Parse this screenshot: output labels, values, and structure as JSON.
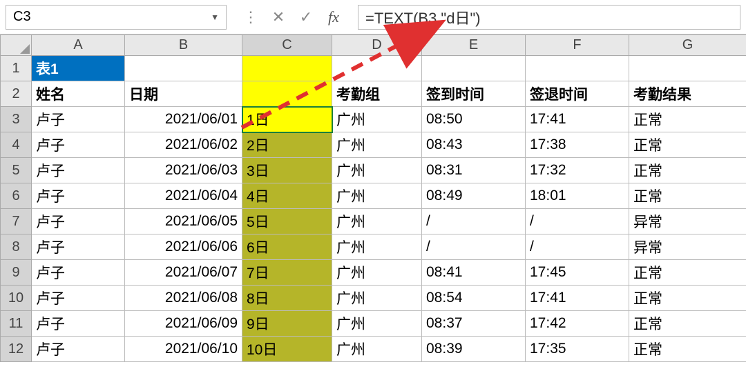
{
  "name_box": "C3",
  "formula": "=TEXT(B3,\"d日\")",
  "columns": [
    "A",
    "B",
    "C",
    "D",
    "E",
    "F",
    "G"
  ],
  "selected_column": "C",
  "title_cell": "表1",
  "headers": {
    "A": "姓名",
    "B": "日期",
    "C": "",
    "D": "考勤组",
    "E": "签到时间",
    "F": "签退时间",
    "G": "考勤结果"
  },
  "rows": [
    {
      "n": 3,
      "A": "卢子",
      "B": "2021/06/01",
      "C": "1日",
      "D": "广州",
      "E": "08:50",
      "F": "17:41",
      "G": "正常"
    },
    {
      "n": 4,
      "A": "卢子",
      "B": "2021/06/02",
      "C": "2日",
      "D": "广州",
      "E": "08:43",
      "F": "17:38",
      "G": "正常"
    },
    {
      "n": 5,
      "A": "卢子",
      "B": "2021/06/03",
      "C": "3日",
      "D": "广州",
      "E": "08:31",
      "F": "17:32",
      "G": "正常"
    },
    {
      "n": 6,
      "A": "卢子",
      "B": "2021/06/04",
      "C": "4日",
      "D": "广州",
      "E": "08:49",
      "F": "18:01",
      "G": "正常"
    },
    {
      "n": 7,
      "A": "卢子",
      "B": "2021/06/05",
      "C": "5日",
      "D": "广州",
      "E": "/",
      "F": "/",
      "G": "异常"
    },
    {
      "n": 8,
      "A": "卢子",
      "B": "2021/06/06",
      "C": "6日",
      "D": "广州",
      "E": "/",
      "F": "/",
      "G": "异常"
    },
    {
      "n": 9,
      "A": "卢子",
      "B": "2021/06/07",
      "C": "7日",
      "D": "广州",
      "E": "08:41",
      "F": "17:45",
      "G": "正常"
    },
    {
      "n": 10,
      "A": "卢子",
      "B": "2021/06/08",
      "C": "8日",
      "D": "广州",
      "E": "08:54",
      "F": "17:41",
      "G": "正常"
    },
    {
      "n": 11,
      "A": "卢子",
      "B": "2021/06/09",
      "C": "9日",
      "D": "广州",
      "E": "08:37",
      "F": "17:42",
      "G": "正常"
    },
    {
      "n": 12,
      "A": "卢子",
      "B": "2021/06/10",
      "C": "10日",
      "D": "广州",
      "E": "08:39",
      "F": "17:35",
      "G": "正常"
    }
  ],
  "row_numbers": [
    1,
    2,
    3,
    4,
    5,
    6,
    7,
    8,
    9,
    10,
    11,
    12
  ]
}
